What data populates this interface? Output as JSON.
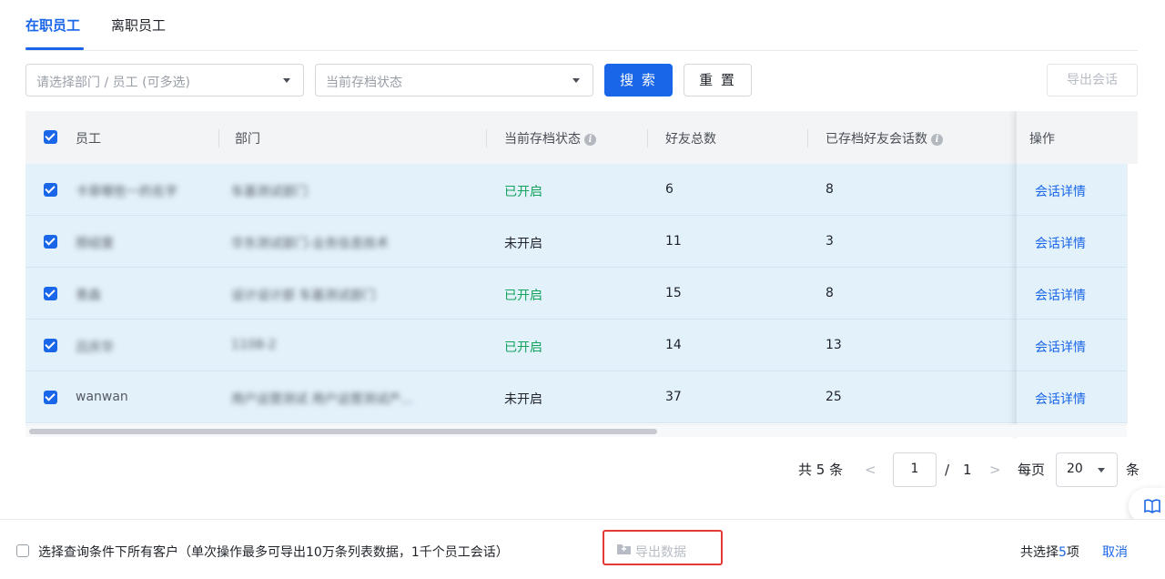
{
  "tabs": [
    {
      "label": "在职员工"
    },
    {
      "label": "离职员工"
    }
  ],
  "filters": {
    "dept_placeholder": "请选择部门 / 员工 (可多选)",
    "status_placeholder": "当前存档状态",
    "search_label": "搜 索",
    "reset_label": "重 置",
    "export_session_label": "导出会话"
  },
  "table": {
    "headers": {
      "employee": "员工",
      "department": "部门",
      "status": "当前存档状态",
      "friends": "好友总数",
      "archived": "已存档好友会话数",
      "action": "操作"
    },
    "rows": [
      {
        "employee": "卡菲哪些一的名字",
        "department": "车基测试部门",
        "status": "已开启",
        "friends": "6",
        "archived": "8",
        "action": "会话详情"
      },
      {
        "employee": "邢绍里",
        "department": "华东测试部门-业务信息技术",
        "status": "未开启",
        "friends": "11",
        "archived": "3",
        "action": "会话详情"
      },
      {
        "employee": "青森",
        "department": "设计设计部 车基测试部门",
        "status": "已开启",
        "friends": "15",
        "archived": "8",
        "action": "会话详情"
      },
      {
        "employee": "吕庆华",
        "department": "1108-2",
        "status": "已开启",
        "friends": "14",
        "archived": "13",
        "action": "会话详情"
      },
      {
        "employee": "wanwan",
        "department": "用户运营测试 用户运营测试产...",
        "status": "未开启",
        "friends": "37",
        "archived": "25",
        "action": "会话详情"
      }
    ]
  },
  "pagination": {
    "total": "共 5 条",
    "prev": "<",
    "page": "1",
    "sep": "/",
    "pages": "1",
    "next": ">",
    "per_page_label": "每页",
    "per_page": "20",
    "unit": "条"
  },
  "footer": {
    "select_all_label": "选择查询条件下所有客户（单次操作最多可导出10万条列表数据，1千个员工会话）",
    "export_data_label": "导出数据",
    "selected_prefix": "共选择",
    "selected_count": "5",
    "selected_suffix": "项",
    "cancel_label": "取消"
  },
  "colors": {
    "accent": "#1a66e8",
    "status_on": "#10a35b",
    "row_selected": "#e3f1fb",
    "highlight_box": "#e53935"
  },
  "icons": {
    "caret": "chevron-down-icon",
    "info": "info-icon",
    "book": "book-icon",
    "folder": "folder-icon",
    "checkbox": "checkbox-icon"
  }
}
